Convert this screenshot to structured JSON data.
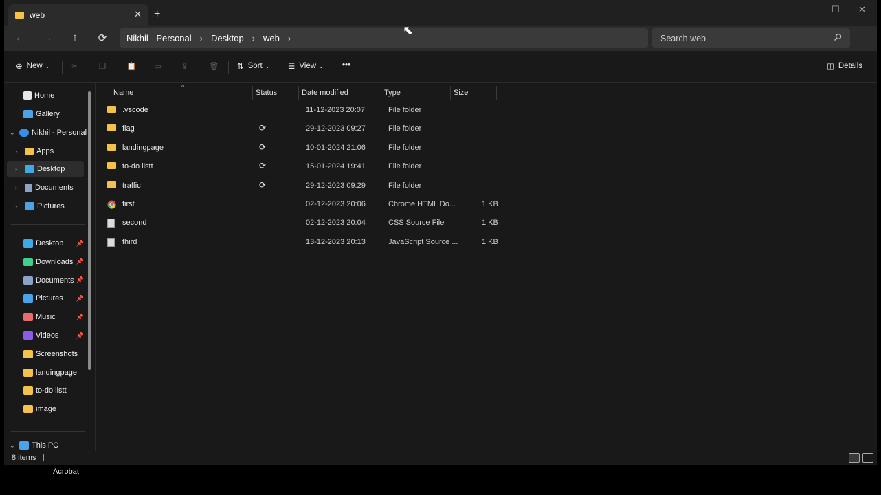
{
  "tab": {
    "title": "web",
    "close": "✕",
    "new": "+"
  },
  "window_controls": {
    "minimize": "—",
    "maximize": "☐",
    "close": "✕"
  },
  "nav": {
    "back": "←",
    "forward": "→",
    "up": "↑",
    "refresh": "⟳"
  },
  "breadcrumb": [
    "Nikhil - Personal",
    "Desktop",
    "web"
  ],
  "search": {
    "placeholder": "Search web"
  },
  "toolbar": {
    "new_label": "New",
    "sort_label": "Sort",
    "view_label": "View",
    "more": "•••",
    "details_label": "Details"
  },
  "sidebar": {
    "home": "Home",
    "gallery": "Gallery",
    "onedrive": "Nikhil - Personal",
    "apps": "Apps",
    "desktop": "Desktop",
    "documents": "Documents",
    "pictures": "Pictures",
    "quick": [
      {
        "label": "Desktop",
        "icon": "desktop-icon",
        "color": "#3fa9e8",
        "pinned": true
      },
      {
        "label": "Downloads",
        "icon": "download-icon",
        "color": "#3fcf8e",
        "pinned": true
      },
      {
        "label": "Documents",
        "icon": "document-icon",
        "color": "#8ca3c7",
        "pinned": true
      },
      {
        "label": "Pictures",
        "icon": "picture-icon",
        "color": "#4aa3e8",
        "pinned": true
      },
      {
        "label": "Music",
        "icon": "music-icon",
        "color": "#e86c6c",
        "pinned": true
      },
      {
        "label": "Videos",
        "icon": "video-icon",
        "color": "#8a5ce8",
        "pinned": true
      },
      {
        "label": "Screenshots",
        "icon": "folder-icon",
        "color": "#f2c24a",
        "pinned": false
      },
      {
        "label": "landingpage",
        "icon": "folder-icon",
        "color": "#f2c24a",
        "pinned": false
      },
      {
        "label": "to-do listt",
        "icon": "folder-icon",
        "color": "#f2c24a",
        "pinned": false
      },
      {
        "label": "image",
        "icon": "folder-icon",
        "color": "#f2c24a",
        "pinned": false
      }
    ],
    "thispc": "This PC"
  },
  "columns": {
    "name": "Name",
    "status": "Status",
    "date": "Date modified",
    "type": "Type",
    "size": "Size"
  },
  "files": [
    {
      "name": ".vscode",
      "icon": "folder-icon",
      "sync": false,
      "date": "11-12-2023 20:07",
      "type": "File folder",
      "size": ""
    },
    {
      "name": "flag",
      "icon": "folder-icon",
      "sync": true,
      "date": "29-12-2023 09:27",
      "type": "File folder",
      "size": ""
    },
    {
      "name": "landingpage",
      "icon": "folder-icon",
      "sync": true,
      "date": "10-01-2024 21:06",
      "type": "File folder",
      "size": ""
    },
    {
      "name": "to-do listt",
      "icon": "folder-icon",
      "sync": true,
      "date": "15-01-2024 19:41",
      "type": "File folder",
      "size": ""
    },
    {
      "name": "traffic",
      "icon": "folder-icon",
      "sync": true,
      "date": "29-12-2023 09:29",
      "type": "File folder",
      "size": ""
    },
    {
      "name": "first",
      "icon": "chrome-icon",
      "sync": false,
      "date": "02-12-2023 20:06",
      "type": "Chrome HTML Do...",
      "size": "1 KB"
    },
    {
      "name": "second",
      "icon": "css-file-icon",
      "sync": false,
      "date": "02-12-2023 20:04",
      "type": "CSS Source File",
      "size": "1 KB"
    },
    {
      "name": "third",
      "icon": "js-file-icon",
      "sync": false,
      "date": "13-12-2023 20:13",
      "type": "JavaScript Source ...",
      "size": "1 KB"
    }
  ],
  "status": {
    "count": "8 items"
  },
  "taskbar": {
    "label": "Acrobat"
  }
}
